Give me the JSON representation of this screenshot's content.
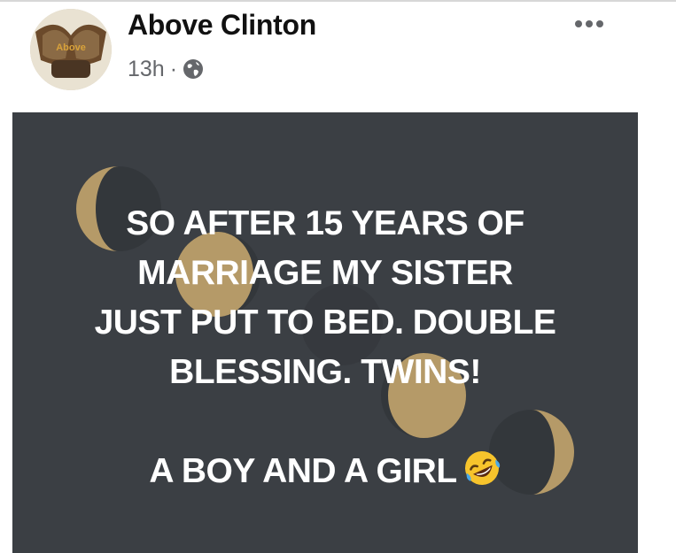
{
  "post": {
    "author": "Above Clinton",
    "time": "13h",
    "separator": "·",
    "privacy_icon": "globe-icon",
    "more_icon": "more-options-icon",
    "avatar_text": "Above"
  },
  "content": {
    "lines": [
      "SO AFTER 15 YEARS OF",
      "MARRIAGE MY SISTER",
      "JUST PUT TO BED. DOUBLE",
      "BLESSING. TWINS!"
    ],
    "last_line": "A BOY AND A GIRL",
    "emoji": "rolling-on-floor-laughing-emoji"
  },
  "colors": {
    "card_background": "#3b3f44",
    "moon_gold": "#b59a68",
    "text": "#ffffff",
    "meta_text": "#65676b"
  }
}
